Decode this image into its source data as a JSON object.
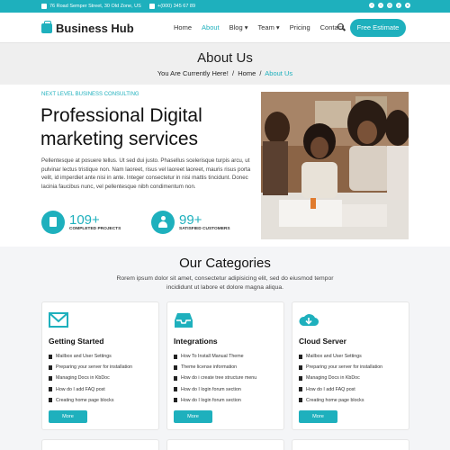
{
  "topbar": {
    "address": "76 Road Semper Street, 30 Old Zone, US",
    "phone": "+(000) 345 67 89",
    "socials": [
      "facebook-icon",
      "twitter-icon",
      "instagram-icon",
      "pinterest-icon",
      "dribbble-icon"
    ]
  },
  "brand": {
    "name": "Business Hub",
    "accent": "#1eb0bd"
  },
  "nav": {
    "items": [
      "Home",
      "About",
      "Blog ▾",
      "Team ▾",
      "Pricing",
      "Contact"
    ],
    "active": "About",
    "cta": "Free Estimate"
  },
  "page_header": {
    "title": "About Us",
    "breadcrumb_prefix": "You Are Currently Here!",
    "sep": "/",
    "crumb_home": "Home",
    "crumb_current": "About Us"
  },
  "hero": {
    "eyebrow": "NEXT LEVEL BUSINESS CONSULTING",
    "title": "Professional Digital marketing services",
    "body": "Pellentesque at posuere tellus. Ut sed dui justo. Phasellus scelerisque turpis arcu, ut pulvinar lectus tristique non. Nam laoreet, risus vel laoreet laoreet, mauris risus porta velit, id imperdiet ante nisi in ante. Integer consectetur in nisi mattis tincidunt. Donec lacinia faucibus nunc, vel pellentesque nibh condimentum non.",
    "stats": [
      {
        "value": "109+",
        "label": "COMPLETED PROJECTS",
        "icon": "document-icon"
      },
      {
        "value": "99+",
        "label": "SATISFIED CUSTOMERS",
        "icon": "user-icon"
      }
    ]
  },
  "categories": {
    "title": "Our Categories",
    "subtitle": "Rorem ipsum dolor sit amet, consectetur adipisicing elit, sed do eiusmod tempor incididunt ut labore et dolore magna aliqua.",
    "cards": [
      {
        "title": "Getting Started",
        "icon": "envelope-icon",
        "items": [
          "Mailbox and User Settings",
          "Preparing your server for installation",
          "Managing Docs in KbDoc",
          "How do I add FAQ post",
          "Creating home page blocks"
        ],
        "button": "More"
      },
      {
        "title": "Integrations",
        "icon": "inbox-icon",
        "items": [
          "How To Install Manual Theme",
          "Theme license information",
          "How do i create tree structure menu",
          "How do I login forum section",
          "How do I login forum section"
        ],
        "button": "More"
      },
      {
        "title": "Cloud Server",
        "icon": "cloud-download-icon",
        "items": [
          "Mailbox and User Settings",
          "Preparing your server for installation",
          "Managing Docs in KbDoc",
          "How do I add FAQ post",
          "Creating home page blocks"
        ],
        "button": "More"
      }
    ]
  }
}
